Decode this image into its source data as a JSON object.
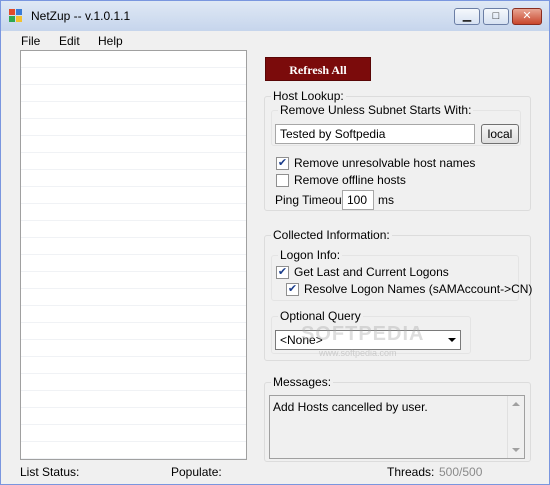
{
  "window": {
    "title": "NetZup  --  v.1.0.1.1",
    "minimize_label": "▁",
    "maximize_label": "□",
    "close_label": "✕"
  },
  "menu": {
    "file": "File",
    "edit": "Edit",
    "help": "Help"
  },
  "refresh_button": "Refresh All",
  "host_lookup": {
    "legend": "Host Lookup:",
    "subnet_label": "Remove Unless Subnet Starts With:",
    "subnet_value": "Tested by Softpedia",
    "local_button": "local",
    "remove_unresolvable": {
      "label": "Remove unresolvable host names",
      "checked": true
    },
    "remove_offline": {
      "label": "Remove offline hosts",
      "checked": false
    },
    "ping_timeout_label": "Ping Timeout",
    "ping_timeout_value": "100",
    "ping_timeout_unit": "ms"
  },
  "collected": {
    "legend": "Collected Information:",
    "logon_legend": "Logon Info:",
    "get_logons": {
      "label": "Get Last and Current Logons",
      "checked": true
    },
    "resolve_names": {
      "label": "Resolve Logon Names (sAMAccount->CN)",
      "checked": true
    },
    "optional_legend": "Optional Query",
    "optional_selected": "<None>"
  },
  "messages": {
    "legend": "Messages:",
    "text": "Add Hosts cancelled by user."
  },
  "status": {
    "list_status_label": "List Status:",
    "populate_label": "Populate:",
    "threads_label": "Threads:",
    "threads_value": "500/500"
  },
  "watermark": {
    "text": "SOFTPEDIA",
    "url": "www.softpedia.com"
  },
  "colors": {
    "refresh_bg": "#7b0b0b",
    "checkbox_check": "#1a3c8a"
  }
}
